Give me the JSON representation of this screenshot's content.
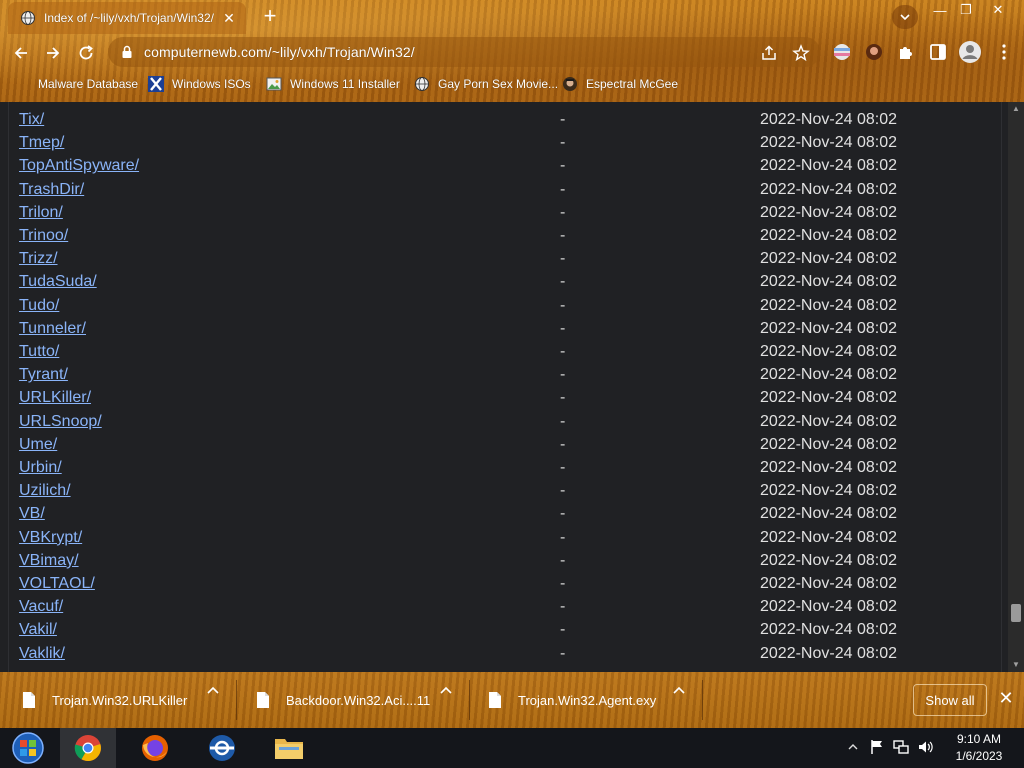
{
  "browser": {
    "tab_title": "Index of /~lily/vxh/Trojan/Win32/",
    "url": "computernewb.com/~lily/vxh/Trojan/Win32/",
    "window_controls": {
      "minimize": "—",
      "restore": "❐",
      "close": "✕"
    },
    "new_tab_glyph": "+",
    "tab_close_glyph": "✕"
  },
  "bookmarks": [
    {
      "label": "Malware Database",
      "icon": "blank-icon"
    },
    {
      "label": "Windows ISOs",
      "icon": "x-logo-icon"
    },
    {
      "label": "Windows 11 Installer",
      "icon": "image-icon"
    },
    {
      "label": "Gay Porn Sex Movie...",
      "icon": "globe-icon"
    },
    {
      "label": "Espectral McGee",
      "icon": "avatar-icon"
    }
  ],
  "listing": {
    "rows": [
      {
        "name": "Tix/",
        "size": "-",
        "date": "2022-Nov-24 08:02"
      },
      {
        "name": "Tmep/",
        "size": "-",
        "date": "2022-Nov-24 08:02"
      },
      {
        "name": "TopAntiSpyware/",
        "size": "-",
        "date": "2022-Nov-24 08:02"
      },
      {
        "name": "TrashDir/",
        "size": "-",
        "date": "2022-Nov-24 08:02"
      },
      {
        "name": "Trilon/",
        "size": "-",
        "date": "2022-Nov-24 08:02"
      },
      {
        "name": "Trinoo/",
        "size": "-",
        "date": "2022-Nov-24 08:02"
      },
      {
        "name": "Trizz/",
        "size": "-",
        "date": "2022-Nov-24 08:02"
      },
      {
        "name": "TudaSuda/",
        "size": "-",
        "date": "2022-Nov-24 08:02"
      },
      {
        "name": "Tudo/",
        "size": "-",
        "date": "2022-Nov-24 08:02"
      },
      {
        "name": "Tunneler/",
        "size": "-",
        "date": "2022-Nov-24 08:02"
      },
      {
        "name": "Tutto/",
        "size": "-",
        "date": "2022-Nov-24 08:02"
      },
      {
        "name": "Tyrant/",
        "size": "-",
        "date": "2022-Nov-24 08:02"
      },
      {
        "name": "URLKiller/",
        "size": "-",
        "date": "2022-Nov-24 08:02"
      },
      {
        "name": "URLSnoop/",
        "size": "-",
        "date": "2022-Nov-24 08:02"
      },
      {
        "name": "Ume/",
        "size": "-",
        "date": "2022-Nov-24 08:02"
      },
      {
        "name": "Urbin/",
        "size": "-",
        "date": "2022-Nov-24 08:02"
      },
      {
        "name": "Uzilich/",
        "size": "-",
        "date": "2022-Nov-24 08:02"
      },
      {
        "name": "VB/",
        "size": "-",
        "date": "2022-Nov-24 08:02"
      },
      {
        "name": "VBKrypt/",
        "size": "-",
        "date": "2022-Nov-24 08:02"
      },
      {
        "name": "VBimay/",
        "size": "-",
        "date": "2022-Nov-24 08:02"
      },
      {
        "name": "VOLTAOL/",
        "size": "-",
        "date": "2022-Nov-24 08:02"
      },
      {
        "name": "Vacuf/",
        "size": "-",
        "date": "2022-Nov-24 08:02"
      },
      {
        "name": "Vakil/",
        "size": "-",
        "date": "2022-Nov-24 08:02"
      },
      {
        "name": "Vaklik/",
        "size": "-",
        "date": "2022-Nov-24 08:02"
      }
    ]
  },
  "downloads": {
    "items": [
      {
        "name": "Trojan.Win32.URLKiller"
      },
      {
        "name": "Backdoor.Win32.Aci....11"
      },
      {
        "name": "Trojan.Win32.Agent.exy"
      }
    ],
    "show_all_label": "Show all",
    "close_glyph": "✕"
  },
  "taskbar": {
    "apps": [
      "start-orb-icon",
      "chrome-icon",
      "firefox-icon",
      "outlook-icon",
      "file-explorer-icon"
    ],
    "clock": {
      "time": "9:10 AM",
      "date": "1/6/2023"
    }
  },
  "colors": {
    "link": "#8ab4f8",
    "page_bg": "#202124",
    "chrome_theme": "#b56c14",
    "taskbar": "#14161b"
  }
}
